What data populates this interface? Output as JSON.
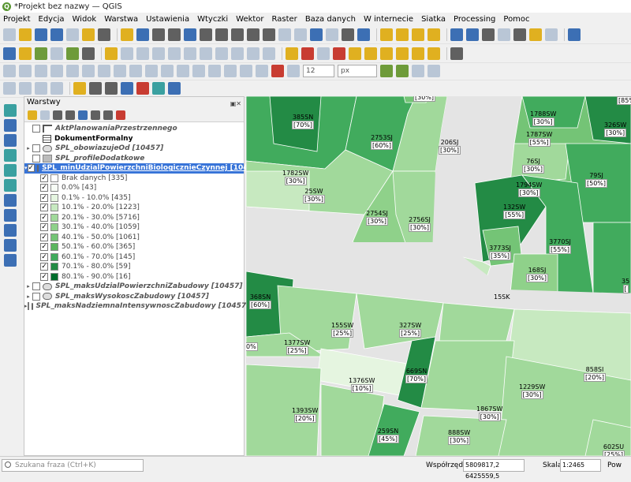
{
  "window": {
    "title": "*Projekt bez nazwy — QGIS"
  },
  "menu": [
    "Projekt",
    "Edycja",
    "Widok",
    "Warstwa",
    "Ustawienia",
    "Wtyczki",
    "Wektor",
    "Raster",
    "Baza danych",
    "W internecie",
    "Siatka",
    "Processing",
    "Pomoc"
  ],
  "toolbar": {
    "symbol_size": "12",
    "symbol_unit": "px"
  },
  "layers_panel": {
    "title": "Warstwy",
    "layers": [
      {
        "name": "AktPlanowaniaPrzestrzennego",
        "style": "italic-bold",
        "icon": "line-icon",
        "expandable": false,
        "checked": false
      },
      {
        "name": "DokumentFormalny",
        "style": "bold",
        "icon": "table-icon",
        "expandable": false,
        "checked": false
      },
      {
        "name": "SPL_obowiazujeOd [10457]",
        "style": "italic",
        "icon": "polygon-icon",
        "expandable": true,
        "checked": false
      },
      {
        "name": "SPL_profileDodatkowe",
        "style": "italic",
        "icon": "raster-icon",
        "expandable": false,
        "checked": false
      },
      {
        "name": "SPL_minUdzialPowierzchniBiologicznieCzynnej [10457]",
        "style": "selected",
        "icon": "polygon-icon",
        "expandable": true,
        "checked": true
      }
    ],
    "legend": [
      {
        "label": "Brak danych [335]",
        "color": "#ffffff"
      },
      {
        "label": "0.0% [43]",
        "color": "#f7fcf5"
      },
      {
        "label": "0.1% - 10.0% [435]",
        "color": "#e5f5e0"
      },
      {
        "label": "10.1% - 20.0% [1223]",
        "color": "#c7e9c0"
      },
      {
        "label": "20.1% - 30.0% [5716]",
        "color": "#a1d99b"
      },
      {
        "label": "30.1% - 40.0% [1059]",
        "color": "#8fd18a"
      },
      {
        "label": "40.1% - 50.0% [1061]",
        "color": "#74c476"
      },
      {
        "label": "50.1% - 60.0% [365]",
        "color": "#5cb55f"
      },
      {
        "label": "60.1% - 70.0% [145]",
        "color": "#41ab5d"
      },
      {
        "label": "70.1% - 80.0% [59]",
        "color": "#238b45"
      },
      {
        "label": "80.1% - 90.0% [16]",
        "color": "#006d2c"
      }
    ],
    "more_layers": [
      "SPL_maksUdzialPowierzchniZabudowy [10457]",
      "SPL_maksWysokoscZabudowy [10457]",
      "SPL_maksNadziemnaIntensywnoscZabudowy [10457]"
    ]
  },
  "map_labels": [
    {
      "code": "",
      "pct": "[30%]"
    },
    {
      "code": "",
      "pct": "[85%"
    },
    {
      "code": "385SN",
      "pct": "[70%]"
    },
    {
      "code": "1788SW",
      "pct": "[30%]"
    },
    {
      "code": "326SW",
      "pct": "[30%]"
    },
    {
      "code": "2753SJ",
      "pct": "[60%]"
    },
    {
      "code": "206SJ",
      "pct": "[30%]"
    },
    {
      "code": "1787SW",
      "pct": "[55%]"
    },
    {
      "code": "76SJ",
      "pct": "[30%]"
    },
    {
      "code": "1782SW",
      "pct": "[30%]"
    },
    {
      "code": "79SJ",
      "pct": "[50%]"
    },
    {
      "code": "1794SW",
      "pct": "[30%]"
    },
    {
      "code": "25SW",
      "pct": "[30%]"
    },
    {
      "code": "132SW",
      "pct": "[55%]"
    },
    {
      "code": "2754SJ",
      "pct": "[30%]"
    },
    {
      "code": "2756SJ",
      "pct": "[30%]"
    },
    {
      "code": "3770SJ",
      "pct": "[55%]"
    },
    {
      "code": "3773SJ",
      "pct": "[35%]"
    },
    {
      "code": "168SJ",
      "pct": "[30%]"
    },
    {
      "code": "35",
      "pct": "["
    },
    {
      "code": "368SN",
      "pct": "[60%]"
    },
    {
      "code": "15SK",
      "pct": ""
    },
    {
      "code": "155SW",
      "pct": "[25%]"
    },
    {
      "code": "327SW",
      "pct": "[25%]"
    },
    {
      "code": "1377SW",
      "pct": "[25%]"
    },
    {
      "code": "",
      "pct": "0%"
    },
    {
      "code": "669SN",
      "pct": "[70%]"
    },
    {
      "code": "858SI",
      "pct": "[20%]"
    },
    {
      "code": "1376SW",
      "pct": "[10%]"
    },
    {
      "code": "1229SW",
      "pct": "[30%]"
    },
    {
      "code": "1393SW",
      "pct": "[20%]"
    },
    {
      "code": "1867SW",
      "pct": "[30%]"
    },
    {
      "code": "259SN",
      "pct": "[45%]"
    },
    {
      "code": "888SW",
      "pct": "[30%]"
    },
    {
      "code": "602SU",
      "pct": "[25%]"
    }
  ],
  "statusbar": {
    "search_placeholder": "Szukana fraza (Ctrl+K)",
    "coord_label": "Współrzędne",
    "coord_value": "5809817,2 6425559,5",
    "scale_label": "Skala",
    "scale_value": "1:2465",
    "extra": "Pow"
  }
}
